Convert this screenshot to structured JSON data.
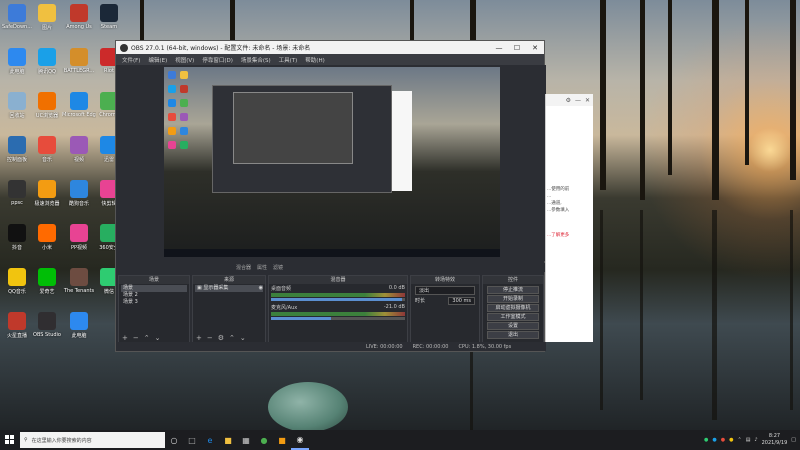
{
  "desktop": {
    "icons": [
      {
        "label": "SafeDown...",
        "color": "#3d7bd9"
      },
      {
        "label": "图片",
        "color": "#f0c040"
      },
      {
        "label": "Among Us",
        "color": "#c0392b"
      },
      {
        "label": "Steam",
        "color": "#1b2838"
      },
      {
        "label": "此电脑",
        "color": "#2d89ef"
      },
      {
        "label": "腾讯QQ",
        "color": "#1aa0e8"
      },
      {
        "label": "BATTLEGR...",
        "color": "#d48e2a"
      },
      {
        "label": "Riot",
        "color": "#cc2a2a"
      },
      {
        "label": "回收站",
        "color": "#8ab0d0"
      },
      {
        "label": "UC浏览器",
        "color": "#f07000"
      },
      {
        "label": "Microsoft Edge",
        "color": "#1e88e5"
      },
      {
        "label": "Chrome",
        "color": "#4caf50"
      },
      {
        "label": "控制面板",
        "color": "#2b6cb0"
      },
      {
        "label": "音乐",
        "color": "#e74c3c"
      },
      {
        "label": "视频",
        "color": "#9b59b6"
      },
      {
        "label": "迅雷",
        "color": "#1e88e5"
      },
      {
        "label": "ppsc",
        "color": "#333333"
      },
      {
        "label": "极速浏览器",
        "color": "#f39c12"
      },
      {
        "label": "酷狗音乐",
        "color": "#2e86de"
      },
      {
        "label": "快剪辑",
        "color": "#e84393"
      },
      {
        "label": "抖音",
        "color": "#111111"
      },
      {
        "label": "小米",
        "color": "#ff6a00"
      },
      {
        "label": "PP视频",
        "color": "#e84393"
      },
      {
        "label": "360安全",
        "color": "#27ae60"
      },
      {
        "label": "QQ音乐",
        "color": "#f1c40f"
      },
      {
        "label": "爱奇艺",
        "color": "#00be06"
      },
      {
        "label": "The Tenants",
        "color": "#6d4c41"
      },
      {
        "label": "微信",
        "color": "#2ecc71"
      },
      {
        "label": "火星直播",
        "color": "#c0392b"
      },
      {
        "label": "OBS Studio",
        "color": "#302e31"
      },
      {
        "label": "此电脑",
        "color": "#2d89ef"
      }
    ]
  },
  "obs": {
    "title": "OBS 27.0.1 (64-bit, windows) - 配置文件: 未命名 - 场景: 未命名",
    "menu": [
      "文件(F)",
      "编辑(E)",
      "视图(V)",
      "停靠窗口(D)",
      "场景集合(S)",
      "工具(T)",
      "帮助(H)"
    ],
    "mixer_tabs": [
      "混合器",
      "属性",
      "滤镜"
    ],
    "docks": {
      "scenes": {
        "header": "场景",
        "items": [
          "场景",
          "场景 2",
          "场景 3"
        ]
      },
      "sources": {
        "header": "来源",
        "items": [
          "显示器采集"
        ]
      },
      "mixer": {
        "header": "混音器",
        "channels": [
          {
            "name": "桌面音频",
            "db": "0.0 dB",
            "level": 0.98
          },
          {
            "name": "麦克风/Aux",
            "db": "-21.0 dB",
            "level": 0.45
          }
        ]
      },
      "transitions": {
        "header": "转场特效",
        "type": "淡出",
        "duration_label": "时长",
        "duration": "300 ms"
      },
      "controls": {
        "header": "控件",
        "buttons": [
          "停止推流",
          "开始录制",
          "启动虚拟摄像机",
          "工作室模式",
          "设置",
          "退出"
        ]
      }
    },
    "status": {
      "live": "LIVE: 00:00:00",
      "rec": "REC: 00:00:00",
      "cpu": "CPU: 1.8%, 30.00 fps"
    }
  },
  "sidewin": {
    "lines": [
      "...使用的前",
      "...",
      "...通道,",
      "...参数填入"
    ],
    "link": "...了解更多"
  },
  "taskbar": {
    "search_placeholder": "在这里输入你要搜索的内容",
    "time": "8:27",
    "date": "2021/9/19"
  }
}
